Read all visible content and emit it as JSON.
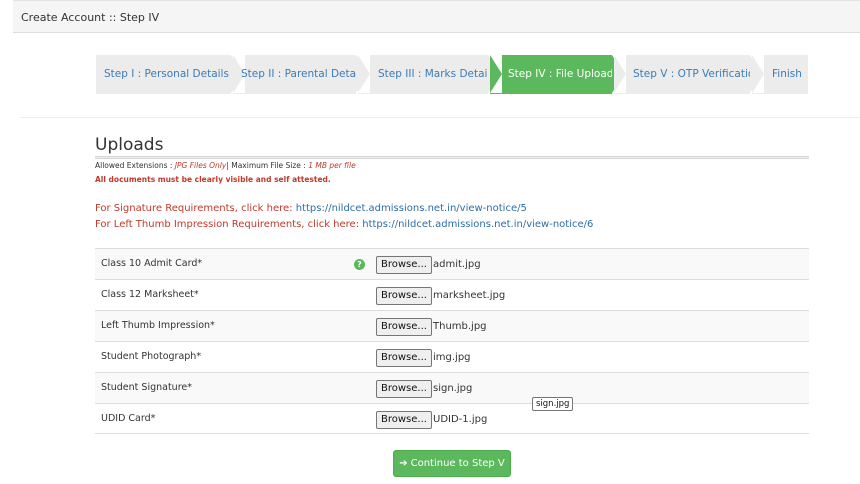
{
  "header": {
    "title": "Create Account :: Step IV"
  },
  "wizard": {
    "steps": [
      {
        "label": "Step I : Personal Details",
        "active": false
      },
      {
        "label": "Step II : Parental Details",
        "active": false
      },
      {
        "label": "Step III : Marks Details",
        "active": false
      },
      {
        "label": "Step IV : File Uploads",
        "active": true
      },
      {
        "label": "Step V : OTP Verification",
        "active": false
      },
      {
        "label": "Finish",
        "active": false
      }
    ]
  },
  "uploads": {
    "title": "Uploads",
    "allowed_prefix": "Allowed Extensions : ",
    "allowed_ext": "JPG Files Only",
    "max_prefix": "| Maximum File Size : ",
    "max_size": "1 MB per file",
    "visible_note": "All documents must be clearly visible and self attested.",
    "signature_req_text": "For Signature Requirements, click here: ",
    "signature_req_link": "https://nildcet.admissions.net.in/view-notice/5",
    "thumb_req_text": "For Left Thumb Impression Requirements, click here: ",
    "thumb_req_link": "https://nildcet.admissions.net.in/view-notice/6",
    "browse_label": "Browse...",
    "rows": [
      {
        "label": "Class 10 Admit Card*",
        "file": "admit.jpg",
        "help": "?"
      },
      {
        "label": "Class 12 Marksheet*",
        "file": "marksheet.jpg"
      },
      {
        "label": "Left Thumb Impression*",
        "file": "Thumb.jpg"
      },
      {
        "label": "Student Photograph*",
        "file": "img.jpg"
      },
      {
        "label": "Student Signature*",
        "file": "sign.jpg"
      },
      {
        "label": "UDID Card*",
        "file": "UDID-1.jpg"
      }
    ],
    "tooltip": "sign.jpg"
  },
  "continue_button": {
    "arrow": "➔",
    "label": "Continue to Step V"
  },
  "colors": {
    "accent_green": "#5cb85c",
    "link_blue": "#2e6da4",
    "warning_red": "#c0392b"
  }
}
